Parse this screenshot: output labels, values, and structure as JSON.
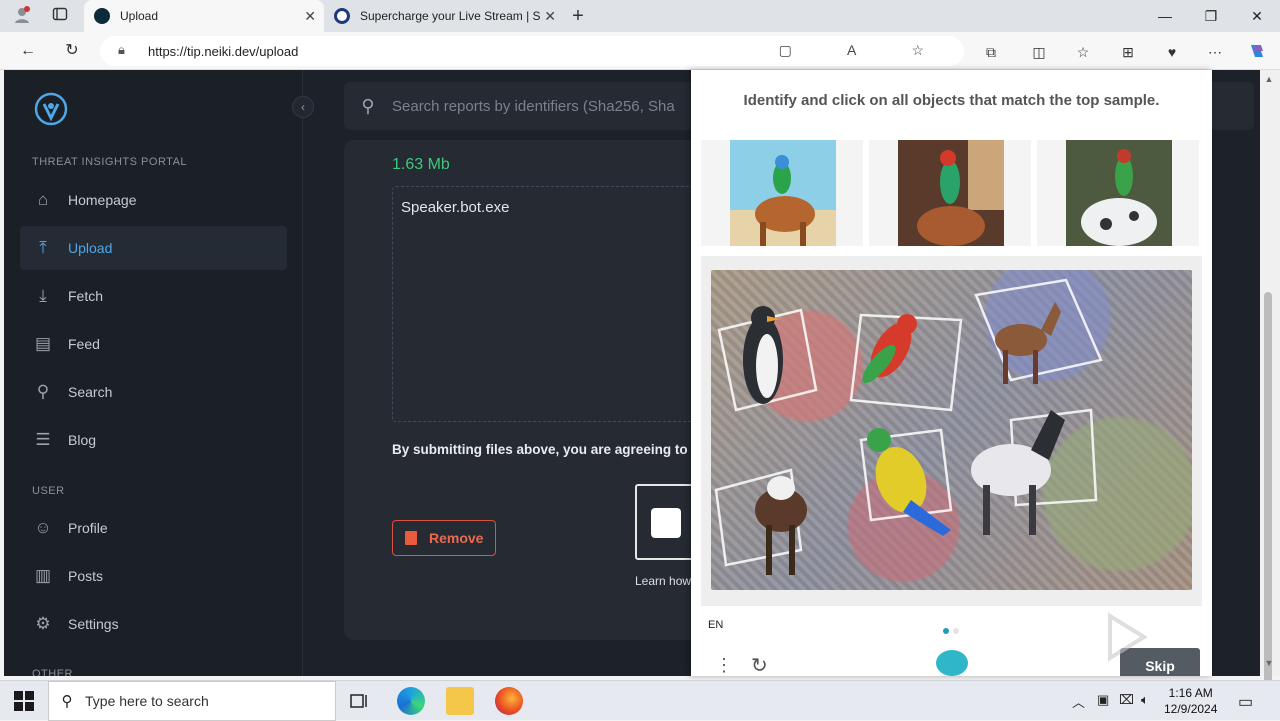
{
  "browser": {
    "tabs": [
      {
        "title": "Upload",
        "active": true
      },
      {
        "title": "Supercharge your Live Stream | S",
        "active": false
      }
    ],
    "url": "https://tip.neiki.dev/upload"
  },
  "sidebar": {
    "section_portal": "THREAT INSIGHTS PORTAL",
    "section_user": "USER",
    "section_other": "OTHER",
    "items": [
      {
        "label": "Homepage",
        "icon": "home-icon"
      },
      {
        "label": "Upload",
        "icon": "upload-icon",
        "active": true
      },
      {
        "label": "Fetch",
        "icon": "download-icon"
      },
      {
        "label": "Feed",
        "icon": "feed-icon"
      },
      {
        "label": "Search",
        "icon": "search-icon"
      },
      {
        "label": "Blog",
        "icon": "blog-icon"
      },
      {
        "label": "Profile",
        "icon": "profile-icon"
      },
      {
        "label": "Posts",
        "icon": "posts-icon"
      },
      {
        "label": "Settings",
        "icon": "gear-icon"
      }
    ]
  },
  "header": {
    "search_placeholder": "Search reports by identifiers (Sha256, Sha"
  },
  "upload": {
    "file_size": "1.63 Mb",
    "file_name": "Speaker.bot.exe",
    "terms_text": "By submitting files above, you are agreeing to",
    "remove_label": "Remove",
    "learn_text": "Learn how"
  },
  "captcha": {
    "instruction": "Identify and click on all objects that match the top sample.",
    "language": "EN",
    "skip_label": "Skip",
    "samples": [
      "parrot-on-cow",
      "parrot-on-cow",
      "parrot-on-cow"
    ]
  },
  "watermark": "ANY.RUN",
  "taskbar": {
    "search_placeholder": "Type here to search",
    "time": "1:16 AM",
    "date": "12/9/2024"
  },
  "colors": {
    "accent": "#4fa7e6",
    "file_size": "#3ec77b",
    "remove": "#ea6a4e"
  }
}
